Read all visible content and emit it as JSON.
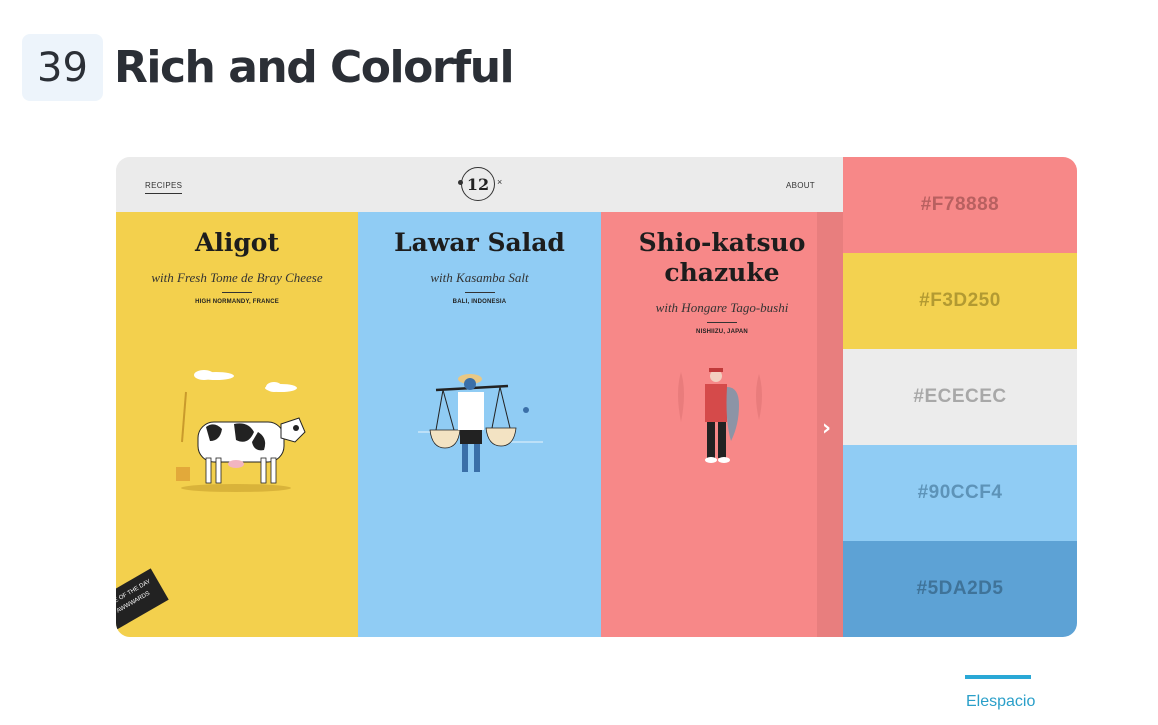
{
  "heading": {
    "number": "39",
    "title": "Rich and Colorful"
  },
  "site": {
    "nav_left": "RECIPES",
    "nav_right": "ABOUT",
    "logo": "12",
    "logo_mark": "×",
    "next_arrow": "›",
    "award": [
      "SITE OF THE DAY",
      "AWWWARDS"
    ],
    "recipes": [
      {
        "name": "Aligot",
        "subtitle": "with Fresh Tome de Bray Cheese",
        "location": "HIGH NORMANDY, FRANCE",
        "illustration": "cow-illustration"
      },
      {
        "name": "Lawar Salad",
        "subtitle": "with Kasamba Salt",
        "location": "BALI, INDONESIA",
        "illustration": "farmer-illustration"
      },
      {
        "name": "Shio-katsuo chazuke",
        "subtitle": "with Hongare Tago-bushi",
        "location": "NISHIIZU, JAPAN",
        "illustration": "fisherman-illustration"
      }
    ]
  },
  "palette": [
    {
      "hex": "#F78888",
      "color": "#f78888",
      "text_color": "#b86060"
    },
    {
      "hex": "#F3D250",
      "color": "#f3d250",
      "text_color": "#b29a32"
    },
    {
      "hex": "#ECECEC",
      "color": "#ececec",
      "text_color": "#a8a8a8"
    },
    {
      "hex": "#90CCF4",
      "color": "#90ccf4",
      "text_color": "#5d93b8"
    },
    {
      "hex": "#5DA2D5",
      "color": "#5da2d5",
      "text_color": "#3f7399"
    }
  ],
  "credit": {
    "label": "Elespacio",
    "accent": "#2aa8d6"
  }
}
